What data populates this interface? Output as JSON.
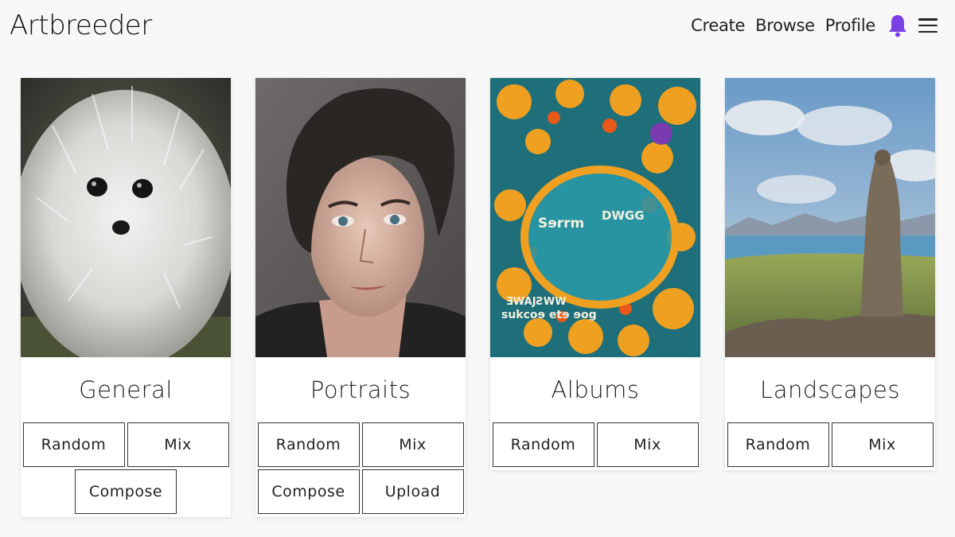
{
  "app": {
    "logo": "Artbreeder"
  },
  "nav": {
    "create": "Create",
    "browse": "Browse",
    "profile": "Profile"
  },
  "colors": {
    "accent": "#7b3fe4",
    "background": "#f7f7f8"
  },
  "cards": [
    {
      "title": "General",
      "image": "fluffy-white-dog-image",
      "buttons": [
        "Random",
        "Mix",
        "Compose"
      ]
    },
    {
      "title": "Portraits",
      "image": "portrait-face-image",
      "buttons": [
        "Random",
        "Mix",
        "Compose",
        "Upload"
      ]
    },
    {
      "title": "Albums",
      "image": "abstract-album-cover-image",
      "buttons": [
        "Random",
        "Mix"
      ]
    },
    {
      "title": "Landscapes",
      "image": "landscape-statue-lake-image",
      "buttons": [
        "Random",
        "Mix"
      ]
    }
  ]
}
